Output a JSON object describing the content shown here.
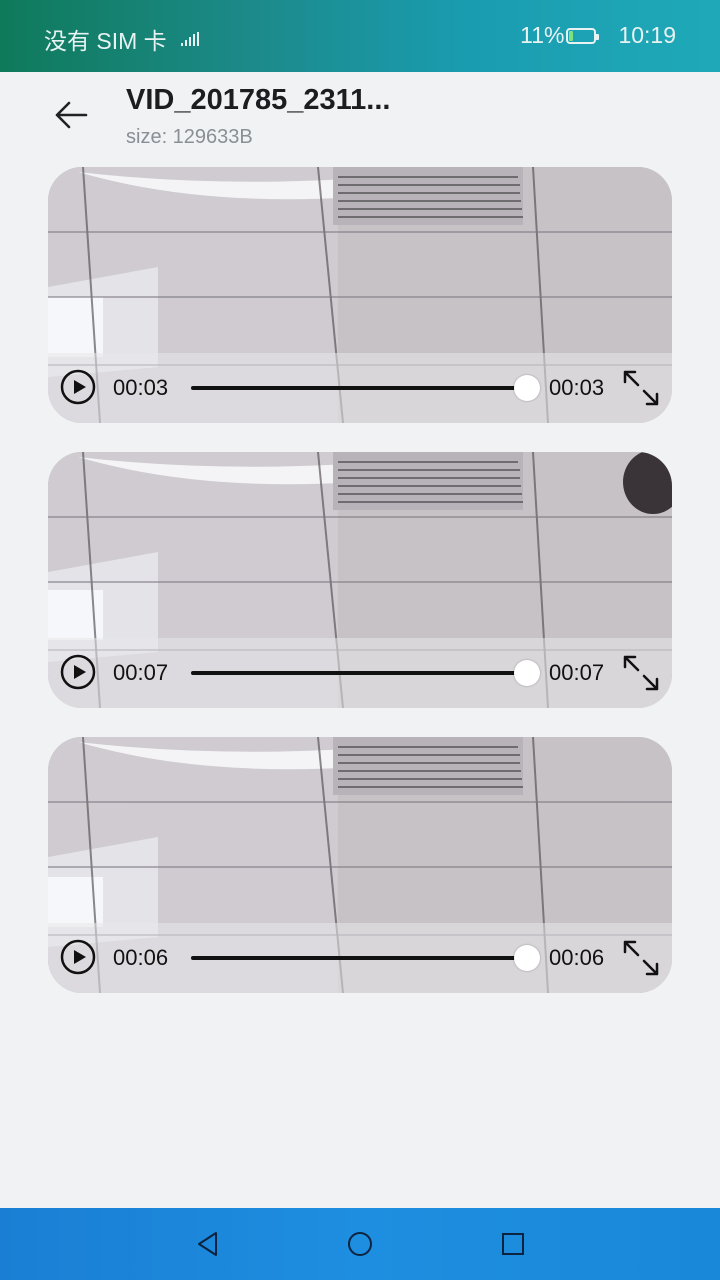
{
  "status_bar": {
    "carrier": "没有 SIM 卡",
    "battery": "11%",
    "time": "10:19"
  },
  "header": {
    "title": "VID_201785_2311...",
    "subtitle": "size: 129633B"
  },
  "videos": [
    {
      "current": "00:03",
      "duration": "00:03",
      "progress": 1.0
    },
    {
      "current": "00:07",
      "duration": "00:07",
      "progress": 1.0
    },
    {
      "current": "00:06",
      "duration": "00:06",
      "progress": 1.0
    }
  ],
  "icons": {
    "back": "back-arrow-icon",
    "play": "play-icon",
    "fullscreen": "fullscreen-icon",
    "nav_back": "triangle-back-icon",
    "nav_home": "circle-home-icon",
    "nav_recent": "square-recents-icon"
  },
  "colors": {
    "status_bar": "#1c8a8a",
    "nav_bar": "#1e8ee0",
    "background": "#f0f2f4",
    "battery_fill": "#7ee07e"
  }
}
